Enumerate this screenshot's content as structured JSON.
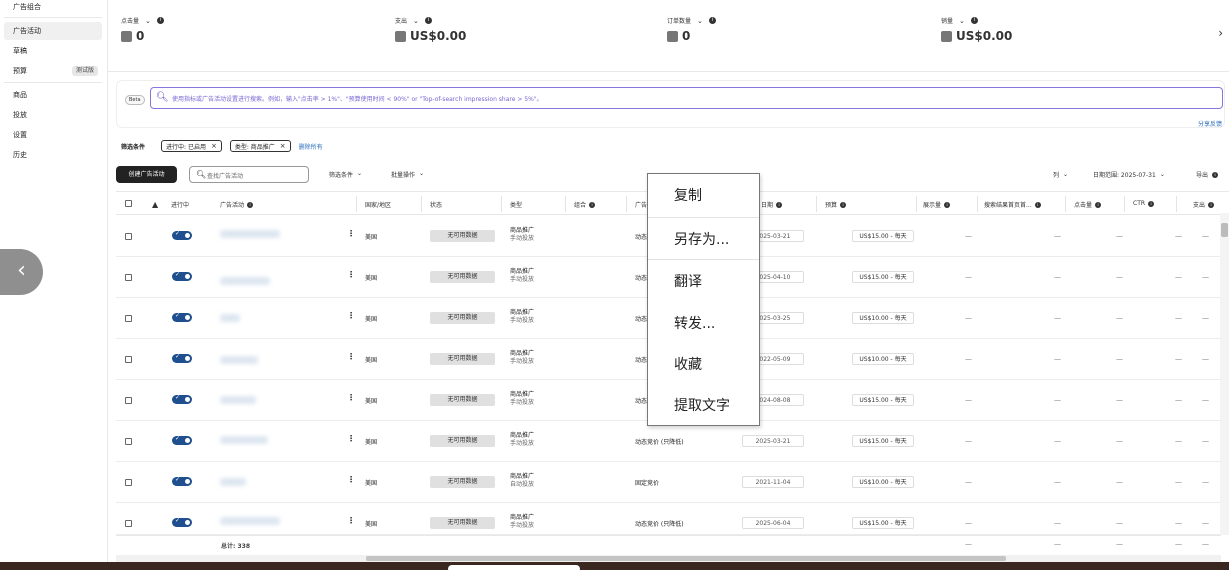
{
  "sidebar": {
    "items": [
      {
        "label": "广告组合"
      },
      {
        "label": "广告活动"
      },
      {
        "label": "草稿"
      },
      {
        "label": "预算",
        "badge": "测试版"
      },
      {
        "label": "商品"
      },
      {
        "label": "投放"
      },
      {
        "label": "设置"
      },
      {
        "label": "历史"
      }
    ]
  },
  "metrics": [
    {
      "label": "点击量",
      "value": "0"
    },
    {
      "label": "支出",
      "value": "US$0.00"
    },
    {
      "label": "订单数量",
      "value": "0"
    },
    {
      "label": "销量",
      "value": "US$0.00"
    }
  ],
  "search": {
    "beta": "Beta",
    "placeholder": "使用指标或广告活动设置进行搜索。例如，输入\"点击率 > 1%\"、\"预算使用时间 < 90%\" or \"Top-of-search impression share > 5%\"。",
    "share_feedback": "分享反馈"
  },
  "filters": {
    "label": "筛选条件",
    "chips": [
      "进行中: 已启用",
      "类型: 商品推广"
    ],
    "clear_all": "删除所有"
  },
  "toolbar": {
    "create_label": "创建广告活动",
    "find_placeholder": "查找广告活动",
    "filter_dropdown": "筛选条件",
    "bulk_dropdown": "批量操作",
    "columns": "列",
    "date_range": "日期范围: 2025-07-31",
    "export": "导出"
  },
  "table": {
    "headers": {
      "active": "进行中",
      "campaign": "广告活动",
      "country": "国家/地区",
      "status": "状态",
      "type": "类型",
      "portfolio": "组合",
      "bidding": "广告",
      "start_date": "日期",
      "budget": "预算",
      "impressions": "展示量",
      "tos_share": "搜索结果首页首...",
      "clicks": "点击量",
      "ctr": "CTR",
      "spend": "支出"
    },
    "rows": [
      {
        "country": "美国",
        "status": "无可用数据",
        "type": "商品推广",
        "type_sub": "手动投放",
        "bid": "动态",
        "date": "2025-03-21",
        "budget": "US$15.00 - 每天"
      },
      {
        "country": "美国",
        "status": "无可用数据",
        "type": "商品推广",
        "type_sub": "手动投放",
        "bid": "动态",
        "date": "2025-04-10",
        "budget": "US$15.00 - 每天"
      },
      {
        "country": "美国",
        "status": "无可用数据",
        "type": "商品推广",
        "type_sub": "手动投放",
        "bid": "动态",
        "date": "2025-03-25",
        "budget": "US$10.00 - 每天"
      },
      {
        "country": "美国",
        "status": "无可用数据",
        "type": "商品推广",
        "type_sub": "手动投放",
        "bid": "动态",
        "date": "2022-05-09",
        "budget": "US$10.00 - 每天"
      },
      {
        "country": "美国",
        "status": "无可用数据",
        "type": "商品推广",
        "type_sub": "手动投放",
        "bid": "动态",
        "date": "2024-08-08",
        "budget": "US$15.00 - 每天"
      },
      {
        "country": "美国",
        "status": "无可用数据",
        "type": "商品推广",
        "type_sub": "手动投放",
        "bid": "动态竞价 (只降低)",
        "date": "2025-03-21",
        "budget": "US$15.00 - 每天"
      },
      {
        "country": "美国",
        "status": "无可用数据",
        "type": "商品推广",
        "type_sub": "自动投放",
        "bid": "固定竞价",
        "date": "2021-11-04",
        "budget": "US$10.00 - 每天"
      },
      {
        "country": "美国",
        "status": "无可用数据",
        "type": "商品推广",
        "type_sub": "手动投放",
        "bid": "动态竞价 (只降低)",
        "date": "2025-06-04",
        "budget": "US$15.00 - 每天"
      }
    ],
    "total_label": "总计: 338",
    "dash": "—"
  },
  "context_menu": {
    "items": [
      "复制",
      "另存为...",
      "翻译",
      "转发...",
      "收藏",
      "提取文字"
    ]
  },
  "colors": {
    "accent": "#1f4f8f",
    "search_border": "#8a74e0",
    "link": "#2a6ebb"
  }
}
